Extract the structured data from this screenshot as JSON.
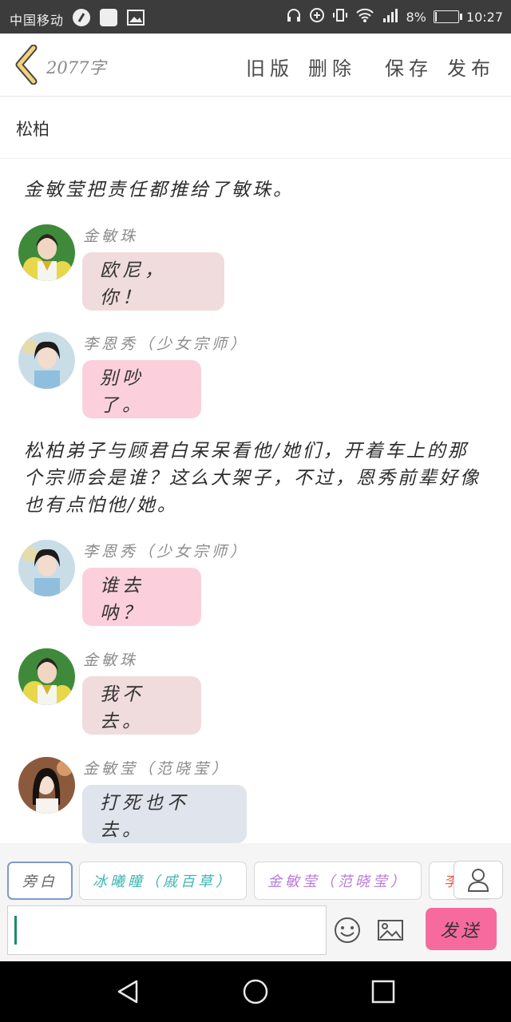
{
  "status_bar": {
    "carrier": "中国移动",
    "battery": "8%",
    "time": "10:27",
    "battery_level": 0.08
  },
  "header": {
    "word_count": "2077字",
    "actions": [
      "旧版",
      "删除",
      "保存",
      "发布"
    ]
  },
  "title": "松柏",
  "story": {
    "narration_1": "金敏莹把责任都推给了敏珠。",
    "narration_2": "松柏弟子与顾君白呆呆看他/她们，开着车上的那个宗师会是谁？这么大架子，不过，恩秀前辈好像也有点怕他/她。",
    "messages": [
      {
        "speaker": "金敏珠",
        "text": "欧尼，你！",
        "bubble_color": "#f0dcdc"
      },
      {
        "speaker": "李恩秀（少女宗师）",
        "text": "别吵了。",
        "bubble_color": "#fbd0dc"
      },
      {
        "speaker": "李恩秀（少女宗师）",
        "text": "谁去呐？",
        "bubble_color": "#fbd0dc"
      },
      {
        "speaker": "金敏珠",
        "text": "我不去。",
        "bubble_color": "#f0dcdc"
      },
      {
        "speaker": "金敏莹（范晓莹）",
        "text": "打死也不去。",
        "bubble_color": "#dfe4ed"
      }
    ]
  },
  "composer": {
    "roles": [
      {
        "label": "旁白",
        "color": "#666666"
      },
      {
        "label": "冰曦瞳（戚百草）",
        "color": "#3fb6b0"
      },
      {
        "label": "金敏莹（范晓莹）",
        "color": "#b77bd6"
      },
      {
        "label": "李",
        "color": "#e0604c"
      }
    ],
    "send": "发送"
  },
  "icons": {
    "back": "back-chevron-icon",
    "person": "person-icon",
    "emoji": "emoji-icon",
    "image": "image-icon",
    "nav_back": "nav-back-icon",
    "nav_home": "nav-home-icon",
    "nav_recent": "nav-recent-icon"
  }
}
